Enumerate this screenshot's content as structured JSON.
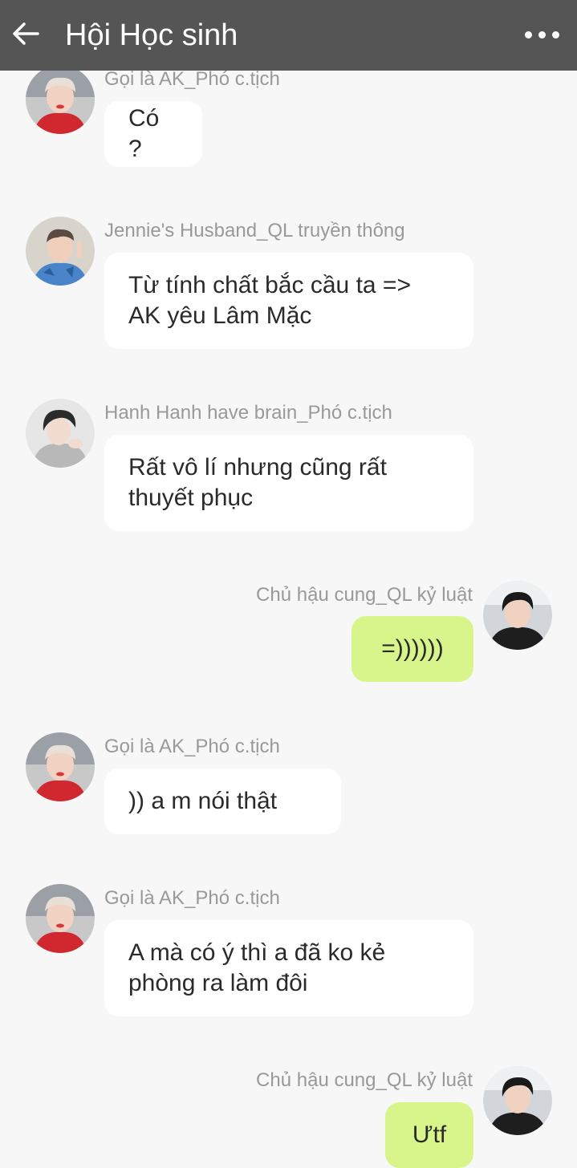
{
  "header": {
    "title": "Hội Học sinh",
    "back_icon": "arrow-left-icon",
    "more_icon": "more-horizontal-icon"
  },
  "colors": {
    "header_bg": "#555555",
    "incoming_bubble": "#ffffff",
    "outgoing_bubble": "#d8f58c",
    "chat_bg": "#f7f7f7",
    "sender_text": "#999999"
  },
  "messages": [
    {
      "sender": "Gọi là AK_Phó c.tịch",
      "lines": [
        "Có ?"
      ],
      "outgoing": false
    },
    {
      "sender": "Jennie's Husband_QL truyền thông",
      "lines": [
        "Từ tính chất bắc cầu ta =>",
        "AK yêu Lâm Mặc"
      ],
      "outgoing": false
    },
    {
      "sender": "Hanh Hanh have brain_Phó c.tịch",
      "lines": [
        "Rất vô lí nhưng cũng rất",
        "thuyết phục"
      ],
      "outgoing": false
    },
    {
      "sender": "Chủ hậu cung_QL kỷ luật",
      "lines": [
        "=))))))"
      ],
      "outgoing": true
    },
    {
      "sender": "Gọi là AK_Phó c.tịch",
      "lines": [
        ")) a m nói thật"
      ],
      "outgoing": false
    },
    {
      "sender": "Gọi là AK_Phó c.tịch",
      "lines": [
        "A mà có ý thì a đã ko kẻ",
        "phòng ra làm đôi"
      ],
      "outgoing": false
    },
    {
      "sender": "Chủ hậu cung_QL kỷ luật",
      "lines": [
        "Ưtf"
      ],
      "outgoing": true
    }
  ]
}
